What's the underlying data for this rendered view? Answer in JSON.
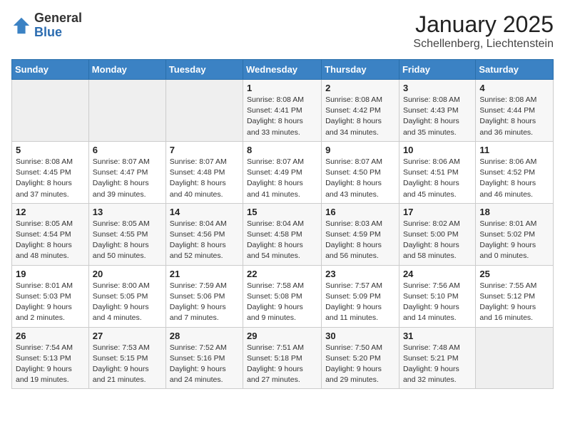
{
  "header": {
    "logo_general": "General",
    "logo_blue": "Blue",
    "month_title": "January 2025",
    "subtitle": "Schellenberg, Liechtenstein"
  },
  "days_of_week": [
    "Sunday",
    "Monday",
    "Tuesday",
    "Wednesday",
    "Thursday",
    "Friday",
    "Saturday"
  ],
  "weeks": [
    [
      {
        "day": "",
        "info": ""
      },
      {
        "day": "",
        "info": ""
      },
      {
        "day": "",
        "info": ""
      },
      {
        "day": "1",
        "info": "Sunrise: 8:08 AM\nSunset: 4:41 PM\nDaylight: 8 hours\nand 33 minutes."
      },
      {
        "day": "2",
        "info": "Sunrise: 8:08 AM\nSunset: 4:42 PM\nDaylight: 8 hours\nand 34 minutes."
      },
      {
        "day": "3",
        "info": "Sunrise: 8:08 AM\nSunset: 4:43 PM\nDaylight: 8 hours\nand 35 minutes."
      },
      {
        "day": "4",
        "info": "Sunrise: 8:08 AM\nSunset: 4:44 PM\nDaylight: 8 hours\nand 36 minutes."
      }
    ],
    [
      {
        "day": "5",
        "info": "Sunrise: 8:08 AM\nSunset: 4:45 PM\nDaylight: 8 hours\nand 37 minutes."
      },
      {
        "day": "6",
        "info": "Sunrise: 8:07 AM\nSunset: 4:47 PM\nDaylight: 8 hours\nand 39 minutes."
      },
      {
        "day": "7",
        "info": "Sunrise: 8:07 AM\nSunset: 4:48 PM\nDaylight: 8 hours\nand 40 minutes."
      },
      {
        "day": "8",
        "info": "Sunrise: 8:07 AM\nSunset: 4:49 PM\nDaylight: 8 hours\nand 41 minutes."
      },
      {
        "day": "9",
        "info": "Sunrise: 8:07 AM\nSunset: 4:50 PM\nDaylight: 8 hours\nand 43 minutes."
      },
      {
        "day": "10",
        "info": "Sunrise: 8:06 AM\nSunset: 4:51 PM\nDaylight: 8 hours\nand 45 minutes."
      },
      {
        "day": "11",
        "info": "Sunrise: 8:06 AM\nSunset: 4:52 PM\nDaylight: 8 hours\nand 46 minutes."
      }
    ],
    [
      {
        "day": "12",
        "info": "Sunrise: 8:05 AM\nSunset: 4:54 PM\nDaylight: 8 hours\nand 48 minutes."
      },
      {
        "day": "13",
        "info": "Sunrise: 8:05 AM\nSunset: 4:55 PM\nDaylight: 8 hours\nand 50 minutes."
      },
      {
        "day": "14",
        "info": "Sunrise: 8:04 AM\nSunset: 4:56 PM\nDaylight: 8 hours\nand 52 minutes."
      },
      {
        "day": "15",
        "info": "Sunrise: 8:04 AM\nSunset: 4:58 PM\nDaylight: 8 hours\nand 54 minutes."
      },
      {
        "day": "16",
        "info": "Sunrise: 8:03 AM\nSunset: 4:59 PM\nDaylight: 8 hours\nand 56 minutes."
      },
      {
        "day": "17",
        "info": "Sunrise: 8:02 AM\nSunset: 5:00 PM\nDaylight: 8 hours\nand 58 minutes."
      },
      {
        "day": "18",
        "info": "Sunrise: 8:01 AM\nSunset: 5:02 PM\nDaylight: 9 hours\nand 0 minutes."
      }
    ],
    [
      {
        "day": "19",
        "info": "Sunrise: 8:01 AM\nSunset: 5:03 PM\nDaylight: 9 hours\nand 2 minutes."
      },
      {
        "day": "20",
        "info": "Sunrise: 8:00 AM\nSunset: 5:05 PM\nDaylight: 9 hours\nand 4 minutes."
      },
      {
        "day": "21",
        "info": "Sunrise: 7:59 AM\nSunset: 5:06 PM\nDaylight: 9 hours\nand 7 minutes."
      },
      {
        "day": "22",
        "info": "Sunrise: 7:58 AM\nSunset: 5:08 PM\nDaylight: 9 hours\nand 9 minutes."
      },
      {
        "day": "23",
        "info": "Sunrise: 7:57 AM\nSunset: 5:09 PM\nDaylight: 9 hours\nand 11 minutes."
      },
      {
        "day": "24",
        "info": "Sunrise: 7:56 AM\nSunset: 5:10 PM\nDaylight: 9 hours\nand 14 minutes."
      },
      {
        "day": "25",
        "info": "Sunrise: 7:55 AM\nSunset: 5:12 PM\nDaylight: 9 hours\nand 16 minutes."
      }
    ],
    [
      {
        "day": "26",
        "info": "Sunrise: 7:54 AM\nSunset: 5:13 PM\nDaylight: 9 hours\nand 19 minutes."
      },
      {
        "day": "27",
        "info": "Sunrise: 7:53 AM\nSunset: 5:15 PM\nDaylight: 9 hours\nand 21 minutes."
      },
      {
        "day": "28",
        "info": "Sunrise: 7:52 AM\nSunset: 5:16 PM\nDaylight: 9 hours\nand 24 minutes."
      },
      {
        "day": "29",
        "info": "Sunrise: 7:51 AM\nSunset: 5:18 PM\nDaylight: 9 hours\nand 27 minutes."
      },
      {
        "day": "30",
        "info": "Sunrise: 7:50 AM\nSunset: 5:20 PM\nDaylight: 9 hours\nand 29 minutes."
      },
      {
        "day": "31",
        "info": "Sunrise: 7:48 AM\nSunset: 5:21 PM\nDaylight: 9 hours\nand 32 minutes."
      },
      {
        "day": "",
        "info": ""
      }
    ]
  ]
}
